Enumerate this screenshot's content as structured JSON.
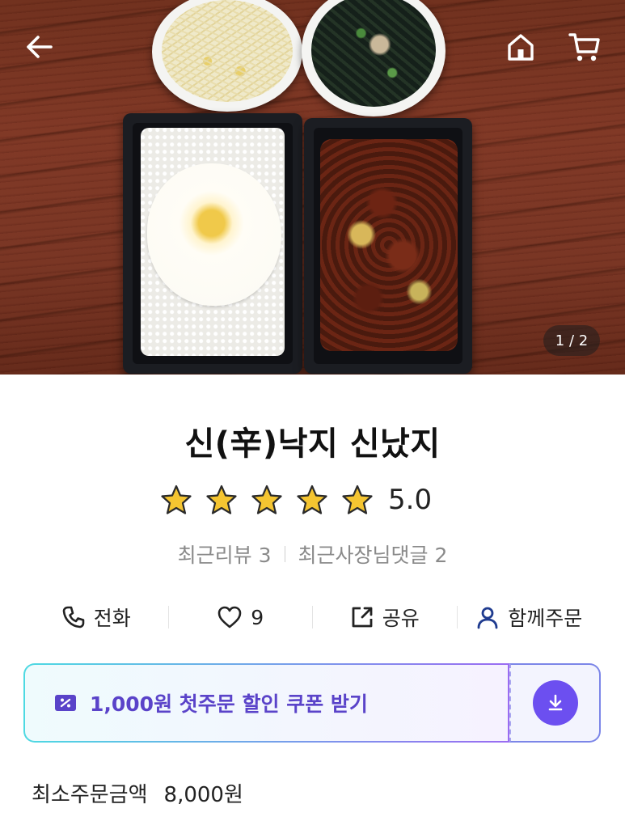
{
  "hero": {
    "page_counter": "1 / 2",
    "back_icon": "arrow-left-icon",
    "home_icon": "home-icon",
    "cart_icon": "cart-icon"
  },
  "store": {
    "name": "신(辛)낙지 신났지",
    "rating": 5,
    "rating_max": 5,
    "rating_text": "5.0",
    "star_color": "#f5c531",
    "recent_reviews": "최근리뷰 3",
    "owner_replies": "최근사장님댓글 2"
  },
  "actions": {
    "call": "전화",
    "likes": "9",
    "share": "공유",
    "group_order": "함께주문"
  },
  "coupon": {
    "label": "1,000원 첫주문 할인 쿠폰 받기",
    "accent": "#6c4ff0"
  },
  "min_order": {
    "label": "최소주문금액",
    "value": "8,000원"
  }
}
